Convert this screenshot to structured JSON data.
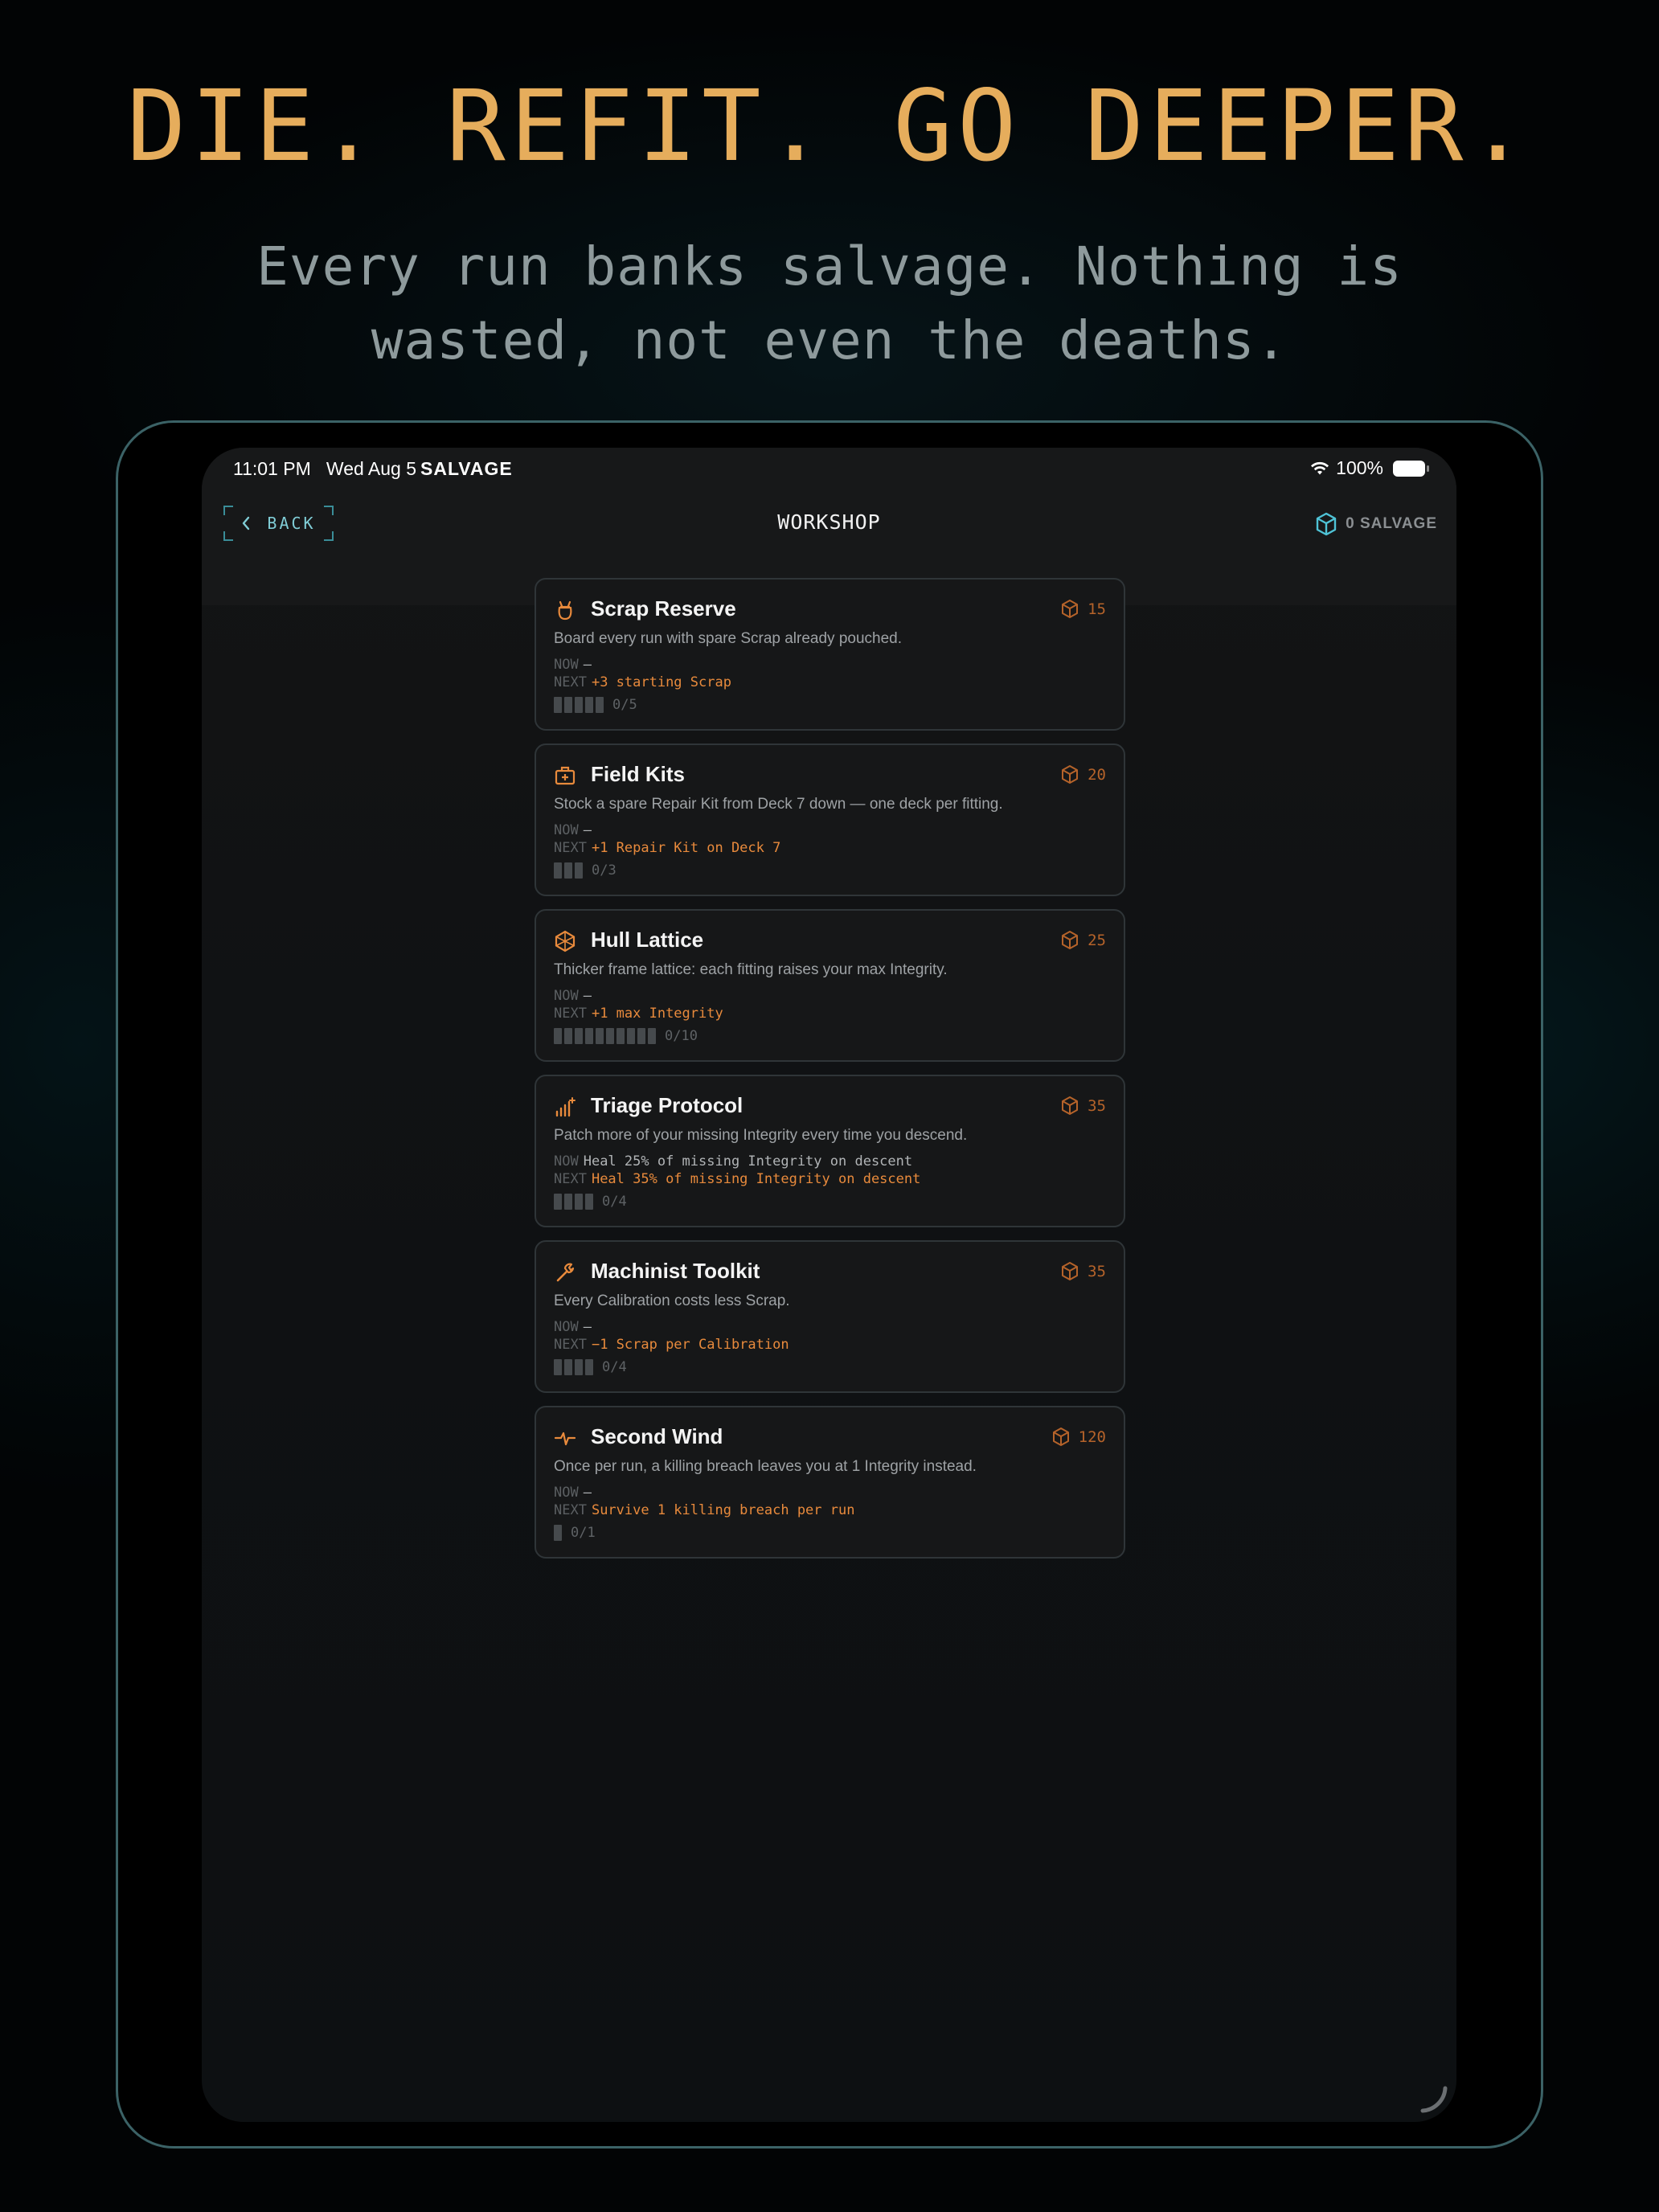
{
  "promo": {
    "headline": "DIE. REFIT. GO DEEPER.",
    "subhead": "Every run banks salvage. Nothing is wasted, not even the deaths."
  },
  "status_bar": {
    "time": "11:01 PM",
    "date": "Wed Aug 5",
    "app": "SALVAGE",
    "battery": "100%"
  },
  "nav": {
    "back_label": "BACK",
    "title": "WORKSHOP",
    "salvage_label": "0 SALVAGE"
  },
  "labels": {
    "now": "NOW",
    "next": "NEXT"
  },
  "colors": {
    "accent": "#e6ad5c",
    "orange": "#e88a3c",
    "cyan": "#4fc3d6"
  },
  "upgrades": [
    {
      "name": "Scrap Reserve",
      "icon": "pouch-icon",
      "cost": "15",
      "description": "Board every run with spare Scrap already pouched.",
      "now": "—",
      "next": "+3 starting Scrap",
      "level": 0,
      "max": 5,
      "progress": "0/5"
    },
    {
      "name": "Field Kits",
      "icon": "medkit-icon",
      "cost": "20",
      "description": "Stock a spare Repair Kit from Deck 7 down — one deck per fitting.",
      "now": "—",
      "next": "+1 Repair Kit on Deck 7",
      "level": 0,
      "max": 3,
      "progress": "0/3"
    },
    {
      "name": "Hull Lattice",
      "icon": "lattice-icon",
      "cost": "25",
      "description": "Thicker frame lattice: each fitting raises your max Integrity.",
      "now": "—",
      "next": "+1 max Integrity",
      "level": 0,
      "max": 10,
      "progress": "0/10"
    },
    {
      "name": "Triage Protocol",
      "icon": "signal-plus-icon",
      "cost": "35",
      "description": "Patch more of your missing Integrity every time you descend.",
      "now": "Heal 25% of missing Integrity on descent",
      "next": "Heal 35% of missing Integrity on descent",
      "level": 0,
      "max": 4,
      "progress": "0/4"
    },
    {
      "name": "Machinist Toolkit",
      "icon": "wrench-icon",
      "cost": "35",
      "description": "Every Calibration costs less Scrap.",
      "now": "—",
      "next": "−1 Scrap per Calibration",
      "level": 0,
      "max": 4,
      "progress": "0/4"
    },
    {
      "name": "Second Wind",
      "icon": "pulse-icon",
      "cost": "120",
      "description": "Once per run, a killing breach leaves you at 1 Integrity instead.",
      "now": "—",
      "next": "Survive 1 killing breach per run",
      "level": 0,
      "max": 1,
      "progress": "0/1"
    }
  ]
}
